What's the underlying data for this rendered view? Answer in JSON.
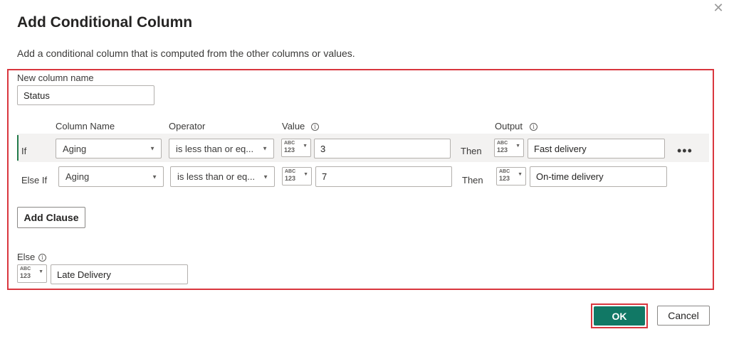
{
  "dialog": {
    "title": "Add Conditional Column",
    "close_icon": "close-icon",
    "description": "Add a conditional column that is computed from the other columns or values."
  },
  "new_column": {
    "label": "New column name",
    "value": "Status"
  },
  "headers": {
    "column_name": "Column Name",
    "operator": "Operator",
    "value": "Value",
    "output": "Output"
  },
  "type_selector": {
    "top": "ABC",
    "bottom": "123"
  },
  "clauses": [
    {
      "keyword": "If",
      "column": "Aging",
      "operator": "is less than or eq...",
      "value": "3",
      "then": "Then",
      "output": "Fast delivery",
      "more": "•••"
    },
    {
      "keyword": "Else If",
      "column": "Aging",
      "operator": "is less than or eq...",
      "value": "7",
      "then": "Then",
      "output": "On-time delivery"
    }
  ],
  "add_clause_label": "Add Clause",
  "else": {
    "label": "Else",
    "value": "Late Delivery"
  },
  "footer": {
    "ok_label": "OK",
    "cancel_label": "Cancel"
  },
  "colors": {
    "accent": "#117865",
    "highlight": "#d9363e",
    "selected_marker": "#237b4b"
  }
}
